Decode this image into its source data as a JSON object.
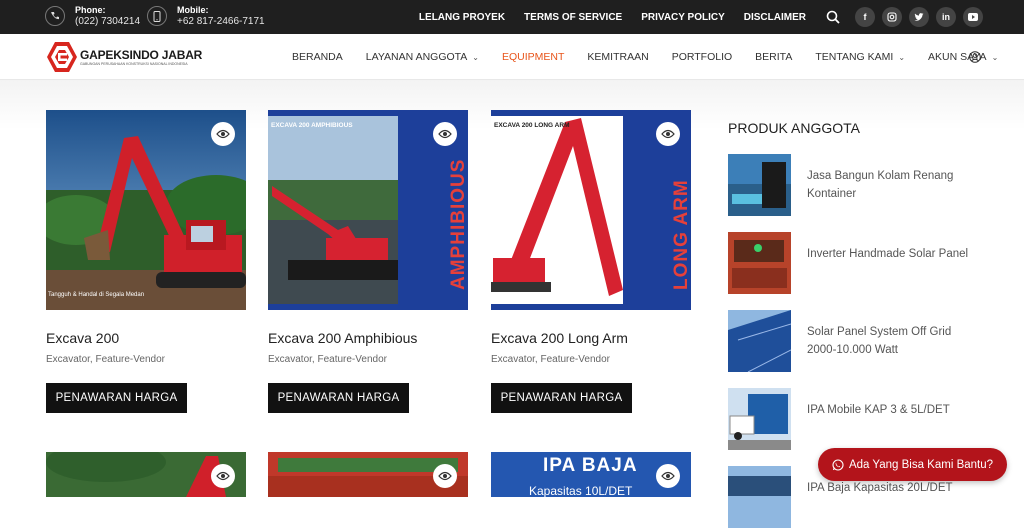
{
  "topbar": {
    "phone_label": "Phone:",
    "phone_value": "(022) 7304214",
    "mobile_label": "Mobile:",
    "mobile_value": "+62 817-2466-7171",
    "links": [
      "LELANG PROYEK",
      "TERMS OF SERVICE",
      "PRIVACY POLICY",
      "DISCLAIMER"
    ],
    "socials": [
      "facebook-icon",
      "instagram-icon",
      "twitter-icon",
      "linkedin-icon",
      "youtube-icon"
    ]
  },
  "brand": {
    "name": "GAPEKSINDO JABAR",
    "tagline": "GABUNGAN PERUSAHAAN KONSTRUKSI NASIONAL INDONESIA",
    "accent": "#e8551b",
    "logo_red": "#d7261e"
  },
  "nav": {
    "items": [
      {
        "label": "BERANDA",
        "dropdown": false,
        "active": false
      },
      {
        "label": "LAYANAN ANGGOTA",
        "dropdown": true,
        "active": false
      },
      {
        "label": "EQUIPMENT",
        "dropdown": false,
        "active": true
      },
      {
        "label": "KEMITRAAN",
        "dropdown": false,
        "active": false
      },
      {
        "label": "PORTFOLIO",
        "dropdown": false,
        "active": false
      },
      {
        "label": "BERITA",
        "dropdown": false,
        "active": false
      },
      {
        "label": "TENTANG KAMI",
        "dropdown": true,
        "active": false
      },
      {
        "label": "AKUN SAYA",
        "dropdown": true,
        "active": false
      }
    ]
  },
  "products": [
    {
      "title": "Excava 200",
      "categories": "Excavator, Feature-Vendor",
      "button": "PENAWARAN HARGA",
      "caption": "Tangguh & Handal di Segala Medan"
    },
    {
      "title": "Excava 200 Amphibious",
      "categories": "Excavator, Feature-Vendor",
      "button": "PENAWARAN HARGA",
      "banner_top": "EXCAVA 200 AMPHIBIOUS",
      "banner_side": "AMPHIBIOUS"
    },
    {
      "title": "Excava 200 Long Arm",
      "categories": "Excavator, Feature-Vendor",
      "button": "PENAWARAN HARGA",
      "banner_top": "EXCAVA 200 LONG ARM",
      "banner_side": "LONG ARM"
    }
  ],
  "next_row": {
    "third_banner_title": "IPA BAJA",
    "third_banner_sub": "Kapasitas 10L/DET"
  },
  "sidebar": {
    "title": "PRODUK ANGGOTA",
    "items": [
      "Jasa Bangun Kolam Renang Kontainer",
      "Inverter Handmade Solar Panel",
      "Solar Panel System Off Grid 2000-10.000 Watt",
      "IPA Mobile KAP 3 & 5L/DET",
      "IPA Baja Kapasitas 20L/DET"
    ]
  },
  "chat": {
    "label": "Ada Yang Bisa Kami Bantu?"
  }
}
